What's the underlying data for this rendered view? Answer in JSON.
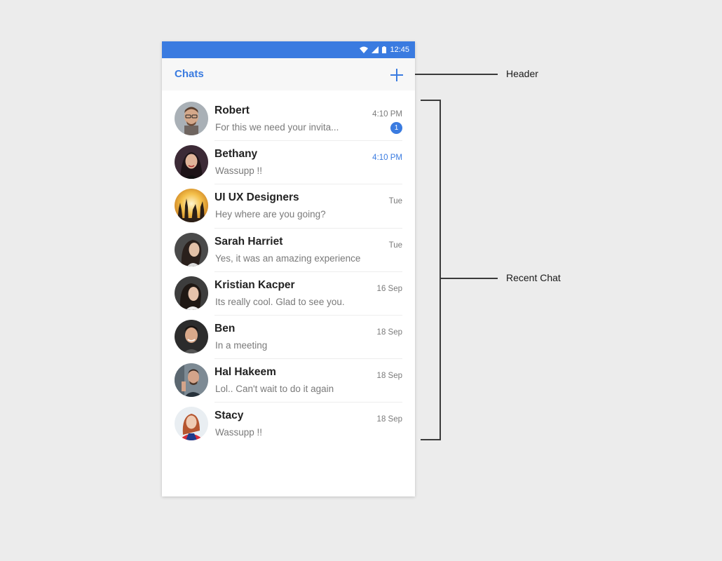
{
  "status_bar": {
    "time": "12:45",
    "bg_color": "#3a7be0"
  },
  "header": {
    "title": "Chats",
    "add_icon": "plus-icon"
  },
  "chats": [
    {
      "name": "Robert",
      "preview": "For this we need your invita...",
      "time": "4:10 PM",
      "unread": "1",
      "time_highlight": false
    },
    {
      "name": "Bethany",
      "preview": "Wassupp !!",
      "time": "4:10 PM",
      "unread": "",
      "time_highlight": true
    },
    {
      "name": "UI UX Designers",
      "preview": "Hey where are you going?",
      "time": "Tue",
      "unread": "",
      "time_highlight": false
    },
    {
      "name": "Sarah Harriet",
      "preview": "Yes, it was an amazing experience",
      "time": "Tue",
      "unread": "",
      "time_highlight": false
    },
    {
      "name": "Kristian Kacper",
      "preview": "Its really cool. Glad to see you.",
      "time": "16 Sep",
      "unread": "",
      "time_highlight": false
    },
    {
      "name": "Ben",
      "preview": "In a meeting",
      "time": "18 Sep",
      "unread": "",
      "time_highlight": false
    },
    {
      "name": "Hal Hakeem",
      "preview": "Lol.. Can't wait to do it again",
      "time": "18 Sep",
      "unread": "",
      "time_highlight": false
    },
    {
      "name": "Stacy",
      "preview": "Wassupp !!",
      "time": "18 Sep",
      "unread": "",
      "time_highlight": false
    }
  ],
  "annotations": {
    "header_label": "Header",
    "recent_chat_label": "Recent Chat"
  },
  "colors": {
    "accent": "#3a7be0",
    "page_bg": "#ececec"
  }
}
